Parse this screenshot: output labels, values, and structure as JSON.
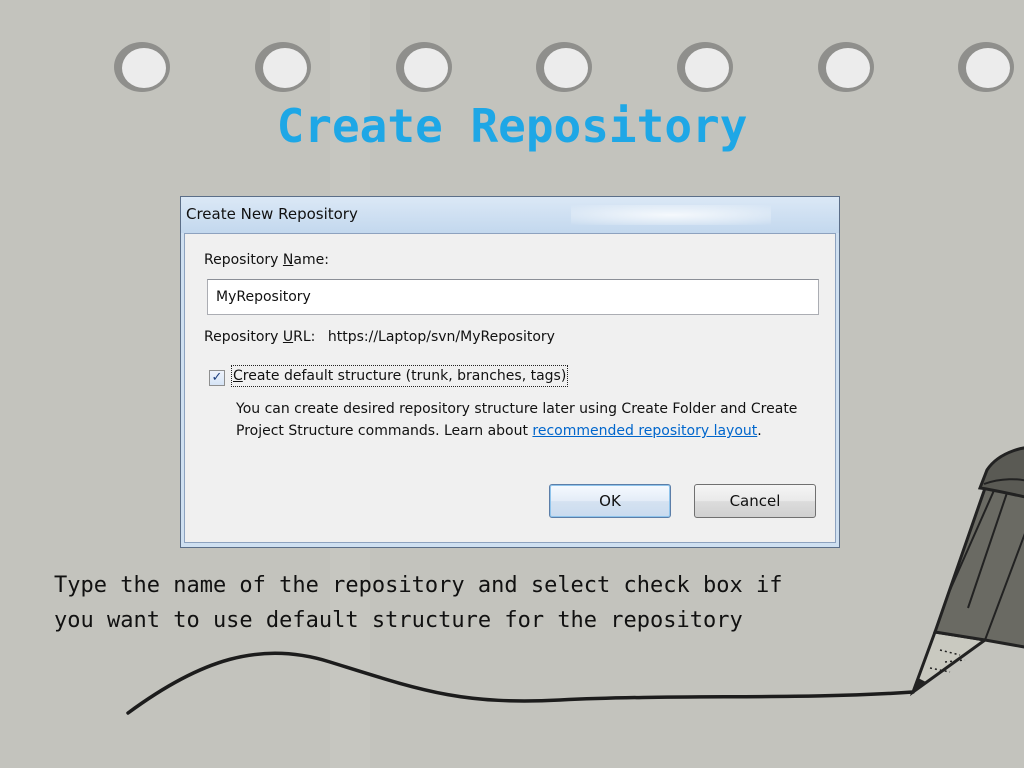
{
  "slide": {
    "title": "Create Repository",
    "caption": "Type the name of the repository and select check box if\nyou want to use default structure for the repository"
  },
  "dialog": {
    "title": "Create New Repository",
    "name_label_pre": "Repository ",
    "name_label_key": "N",
    "name_label_post": "ame:",
    "name_value": "MyRepository",
    "url_label_pre": "Repository ",
    "url_label_key": "U",
    "url_label_post": "RL:",
    "url_value": "https://Laptop/svn/MyRepository",
    "checkbox_checked": true,
    "checkbox_mark": "✓",
    "checkbox_label_key": "C",
    "checkbox_label_post": "reate default structure (trunk, branches, tags)",
    "help_text": "You can create desired repository structure later using Create Folder and Create Project Structure commands. Learn about ",
    "help_link": "recommended repository layout",
    "help_end": ".",
    "ok_label": "OK",
    "cancel_label": "Cancel"
  },
  "colors": {
    "title": "#1ea7e6",
    "background": "#c3c3bd",
    "link": "#0066cc"
  },
  "icons": [
    "binder-hole-icon",
    "pencil-icon",
    "checkmark-icon"
  ]
}
